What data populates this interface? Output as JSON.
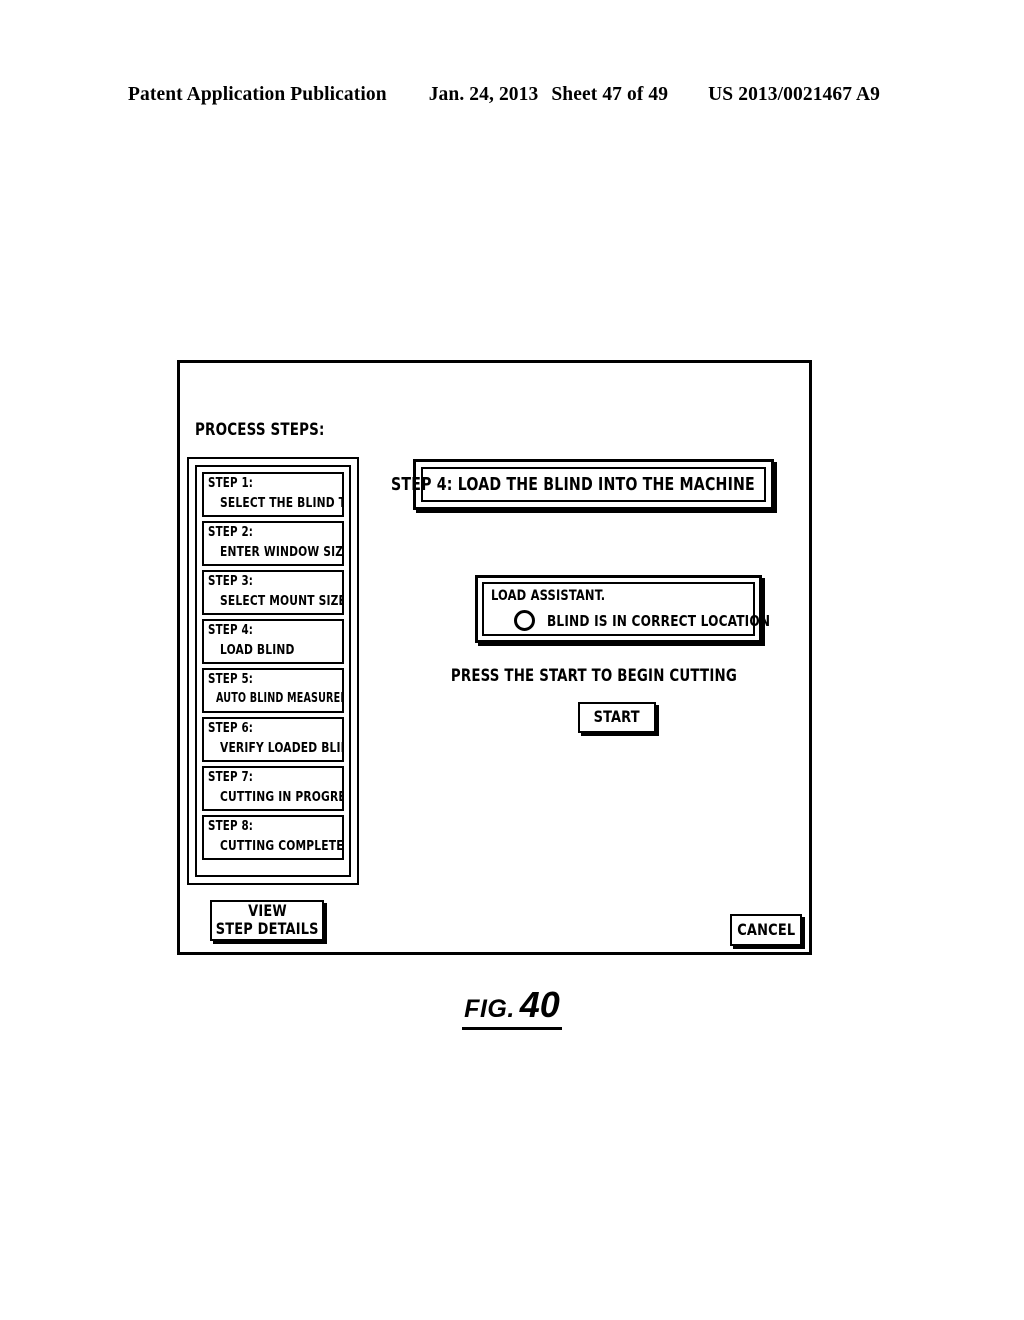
{
  "header": {
    "title": "Patent Application Publication",
    "date": "Jan. 24, 2013",
    "sheet": "Sheet 47 of 49",
    "number": "US 2013/0021467 A9"
  },
  "figure": {
    "label": "FIG.",
    "number": "40"
  },
  "screen": {
    "steps_heading": "PROCESS STEPS:",
    "steps": [
      {
        "num": "STEP 1:",
        "label": "SELECT THE BLIND TYPE"
      },
      {
        "num": "STEP 2:",
        "label": "ENTER WINDOW SIZE"
      },
      {
        "num": "STEP 3:",
        "label": "SELECT MOUNT SIZE"
      },
      {
        "num": "STEP 4:",
        "label": "LOAD BLIND"
      },
      {
        "num": "STEP 5:",
        "label": "AUTO BLIND MEASUREMENT"
      },
      {
        "num": "STEP 6:",
        "label": "VERIFY LOADED BLIND"
      },
      {
        "num": "STEP 7:",
        "label": "CUTTING IN PROGRESS"
      },
      {
        "num": "STEP 8:",
        "label": "CUTTING COMPLETED"
      }
    ],
    "banner_title": "STEP 4: LOAD THE BLIND INTO THE MACHINE",
    "load_assistant": {
      "title": "LOAD ASSISTANT.",
      "status_label": "BLIND IS IN CORRECT LOCATION",
      "indicator_state": "empty"
    },
    "press_prompt": "PRESS THE START TO BEGIN CUTTING",
    "start_button": "START",
    "view_details_line1": "VIEW",
    "view_details_line2": "STEP DETAILS",
    "cancel_button": "CANCEL"
  }
}
